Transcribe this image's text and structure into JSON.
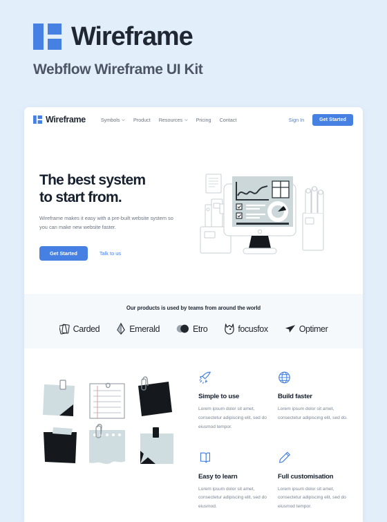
{
  "page": {
    "background_color": "#e3eefb",
    "brand_blue": "#4680e3",
    "title": "Wireframe",
    "subtitle": "Webflow Wireframe UI Kit",
    "logo_icon": "wireframe-logo-icon"
  },
  "nav": {
    "logo_text": "Wireframe",
    "logo_icon": "wireframe-logo-icon",
    "links": [
      {
        "label": "Symbols",
        "has_dropdown": true
      },
      {
        "label": "Product",
        "has_dropdown": false
      },
      {
        "label": "Resources",
        "has_dropdown": true
      },
      {
        "label": "Pricing",
        "has_dropdown": false
      },
      {
        "label": "Contact",
        "has_dropdown": false
      }
    ],
    "sign_in": "Sign In",
    "cta": "Get Started"
  },
  "hero": {
    "title_line1": "The best system",
    "title_line2": "to start from.",
    "body": "Wireframe makes it easy with a pre-built website system so you can make new website faster.",
    "primary_cta": "Get Started",
    "secondary_cta": "Talk to us",
    "illustration": "desktop-computer-dashboard-illustration"
  },
  "logo_strip": {
    "heading": "Our products is used by teams from around the world",
    "logos": [
      {
        "name": "Carded",
        "icon": "cards-stack-icon"
      },
      {
        "name": "Emerald",
        "icon": "gem-icon"
      },
      {
        "name": "Etro",
        "icon": "two-circles-icon"
      },
      {
        "name": "focusfox",
        "icon": "fox-head-icon"
      },
      {
        "name": "Optimer",
        "icon": "paper-plane-icon"
      }
    ]
  },
  "features": {
    "illustration": "sticky-notes-collection-illustration",
    "items": [
      {
        "icon": "rocket-icon",
        "title": "Simple to use",
        "text": "Lorem ipsum dolor sit amet, consectetur adipiscing elit, sed do eiusmod tempor."
      },
      {
        "icon": "globe-icon",
        "title": "Build faster",
        "text": "Lorem ipsum dolor sit amet, consectetur adipiscing elit, sed do."
      },
      {
        "icon": "book-icon",
        "title": "Easy to learn",
        "text": "Lorem ipsum dolor sit amet, consectetur adipiscing elit, sed do eiusmod."
      },
      {
        "icon": "pencil-icon",
        "title": "Full customisation",
        "text": "Lorem ipsum dolor sit amet, consectetur adipiscing elit, sed do eiusmod tempor."
      }
    ]
  }
}
